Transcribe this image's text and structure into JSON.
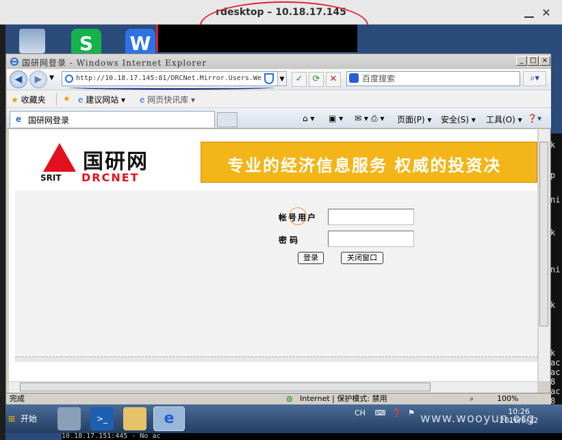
{
  "rdesktop": {
    "title": "rdesktop – 10.18.17.145",
    "close": "✕"
  },
  "right_terminal": [
    "k",
    "p",
    "ni",
    "k",
    "ni",
    "k",
    "k",
    "ac",
    "ac",
    "8",
    "ac",
    "8"
  ],
  "bottom_terminal": "10.18.17.151:445    - No ac",
  "ie": {
    "title": "国研网登录 - Windows Internet Explorer",
    "address": "http://10.18.17.145:81/DRCNet.Mirror.Users.We",
    "search_placeholder": "百度搜索",
    "favorites": [
      "收藏夹",
      "建议网站",
      "网页快讯库"
    ],
    "tab_title": "国研网登录",
    "commands": [
      "页面(P)",
      "安全(S)",
      "工具(O)"
    ],
    "status": {
      "left": "完成",
      "zone": "Internet | 保护模式: 禁用",
      "zoom": "100%"
    }
  },
  "page": {
    "logo_cn": "国研网",
    "logo_srit": "SRIT",
    "logo_drcnet": "DRCNET",
    "banner": "专业的经济信息服务  权威的投资决",
    "account_label": "帐号用户",
    "password_label": "密 码",
    "login_button": "登录",
    "close_button": "关闭窗口",
    "account_value": "",
    "password_value": ""
  },
  "taskbar": {
    "start": "开始",
    "lang": "CH",
    "time": "10:26",
    "date": "2016/9/12",
    "watermark": "www.wooyun.org"
  }
}
